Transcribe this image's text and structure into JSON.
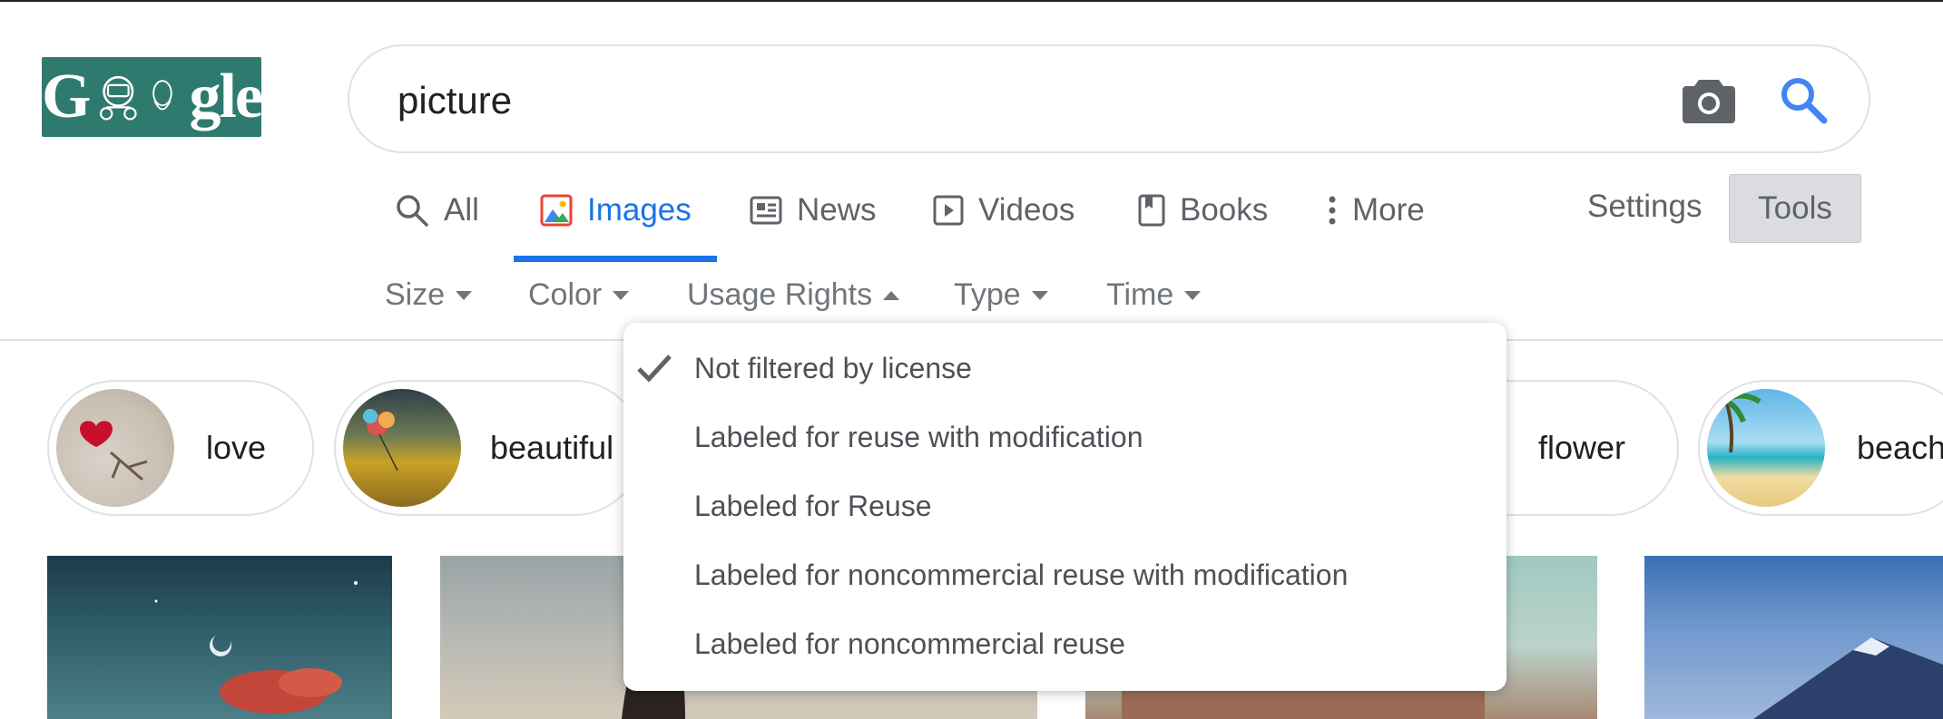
{
  "logo": {
    "text_left": "G",
    "text_right": "gle"
  },
  "search": {
    "query": "picture"
  },
  "tabs": [
    {
      "label": "All",
      "icon": "search-icon"
    },
    {
      "label": "Images",
      "icon": "image-icon"
    },
    {
      "label": "News",
      "icon": "news-icon"
    },
    {
      "label": "Videos",
      "icon": "play-icon"
    },
    {
      "label": "Books",
      "icon": "book-icon"
    },
    {
      "label": "More",
      "icon": "more-vert-icon"
    }
  ],
  "active_tab": "Images",
  "settings_label": "Settings",
  "tools_label": "Tools",
  "filters": [
    {
      "label": "Size",
      "caret": "down"
    },
    {
      "label": "Color",
      "caret": "down"
    },
    {
      "label": "Usage Rights",
      "caret": "up"
    },
    {
      "label": "Type",
      "caret": "down"
    },
    {
      "label": "Time",
      "caret": "down"
    }
  ],
  "chips": [
    "love",
    "beautiful",
    "flower",
    "beach"
  ],
  "usage_rights_menu": {
    "selected_index": 0,
    "options": [
      "Not filtered by license",
      "Labeled for reuse with modification",
      "Labeled for Reuse",
      "Labeled for noncommercial reuse with modification",
      "Labeled for noncommercial reuse"
    ]
  },
  "colors": {
    "accent": "#1a73e8",
    "logo_bg": "#2f7a6e",
    "text_muted": "#5f6368"
  }
}
